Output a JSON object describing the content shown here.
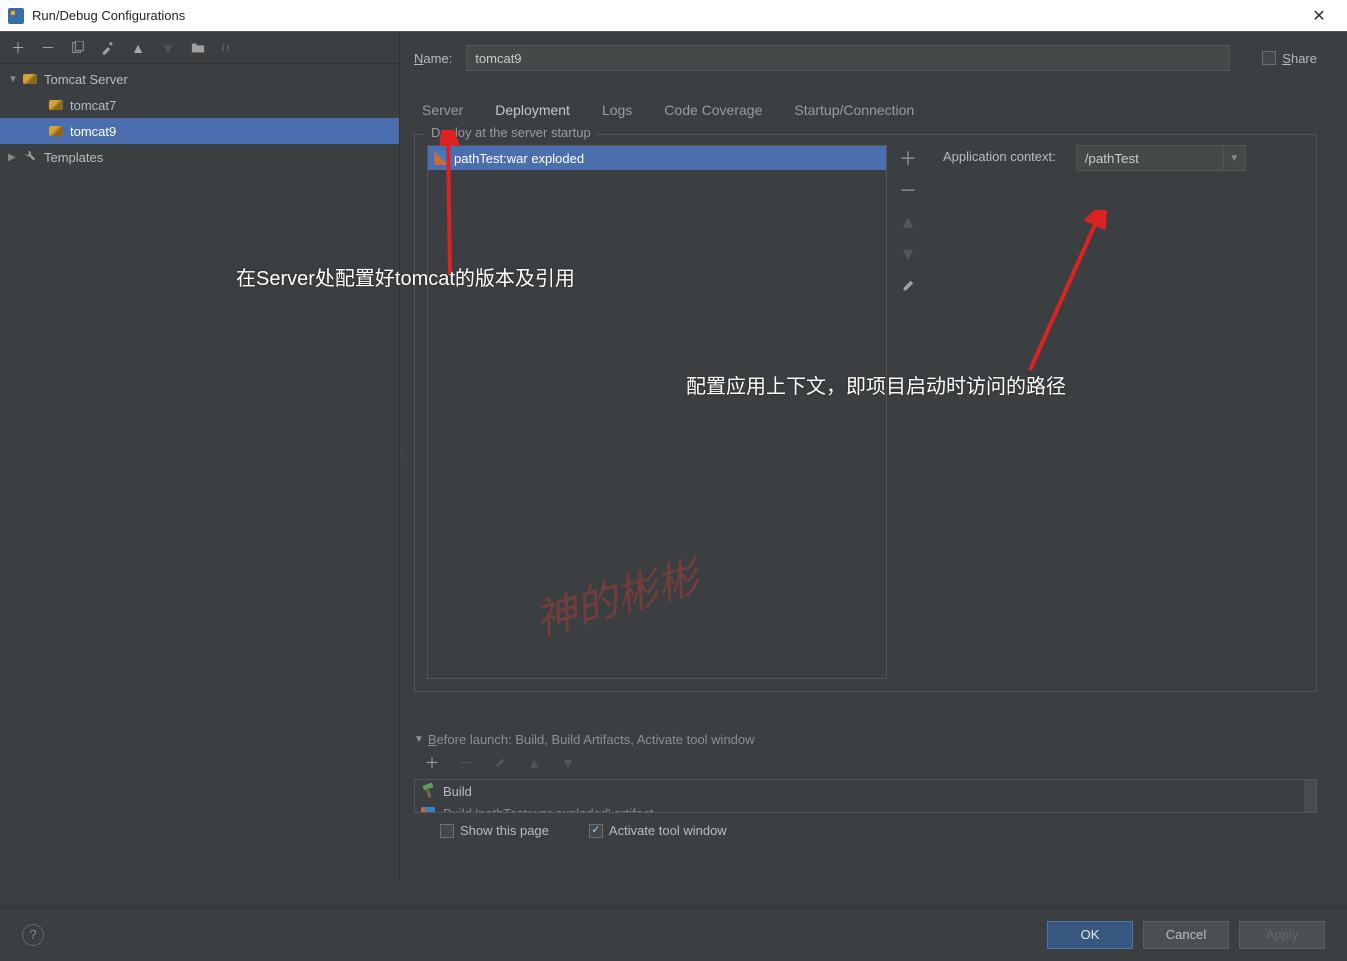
{
  "window": {
    "title": "Run/Debug Configurations"
  },
  "tree": {
    "root": "Tomcat Server",
    "children": [
      "tomcat7",
      "tomcat9"
    ],
    "templates": "Templates"
  },
  "name": {
    "label": "Name:",
    "value": "tomcat9",
    "share_label": "Share"
  },
  "tabs": {
    "server": "Server",
    "deployment": "Deployment",
    "logs": "Logs",
    "coverage": "Code Coverage",
    "startup": "Startup/Connection"
  },
  "deploy": {
    "title": "Deploy at the server startup",
    "artifact": "pathTest:war exploded",
    "context_label": "Application context:",
    "context_value": "/pathTest"
  },
  "before_launch": {
    "header": "Before launch: Build, Build Artifacts, Activate tool window",
    "item1": "Build",
    "item2": "Build 'pathTest:war exploded' artifact",
    "show_page": "Show this page",
    "activate": "Activate tool window"
  },
  "footer": {
    "ok": "OK",
    "cancel": "Cancel",
    "apply": "Apply"
  },
  "annotations": {
    "a1": "在Server处配置好tomcat的版本及引用",
    "a2": "配置应用上下文，即项目启动时访问的路径",
    "watermark": "神的彬彬"
  }
}
